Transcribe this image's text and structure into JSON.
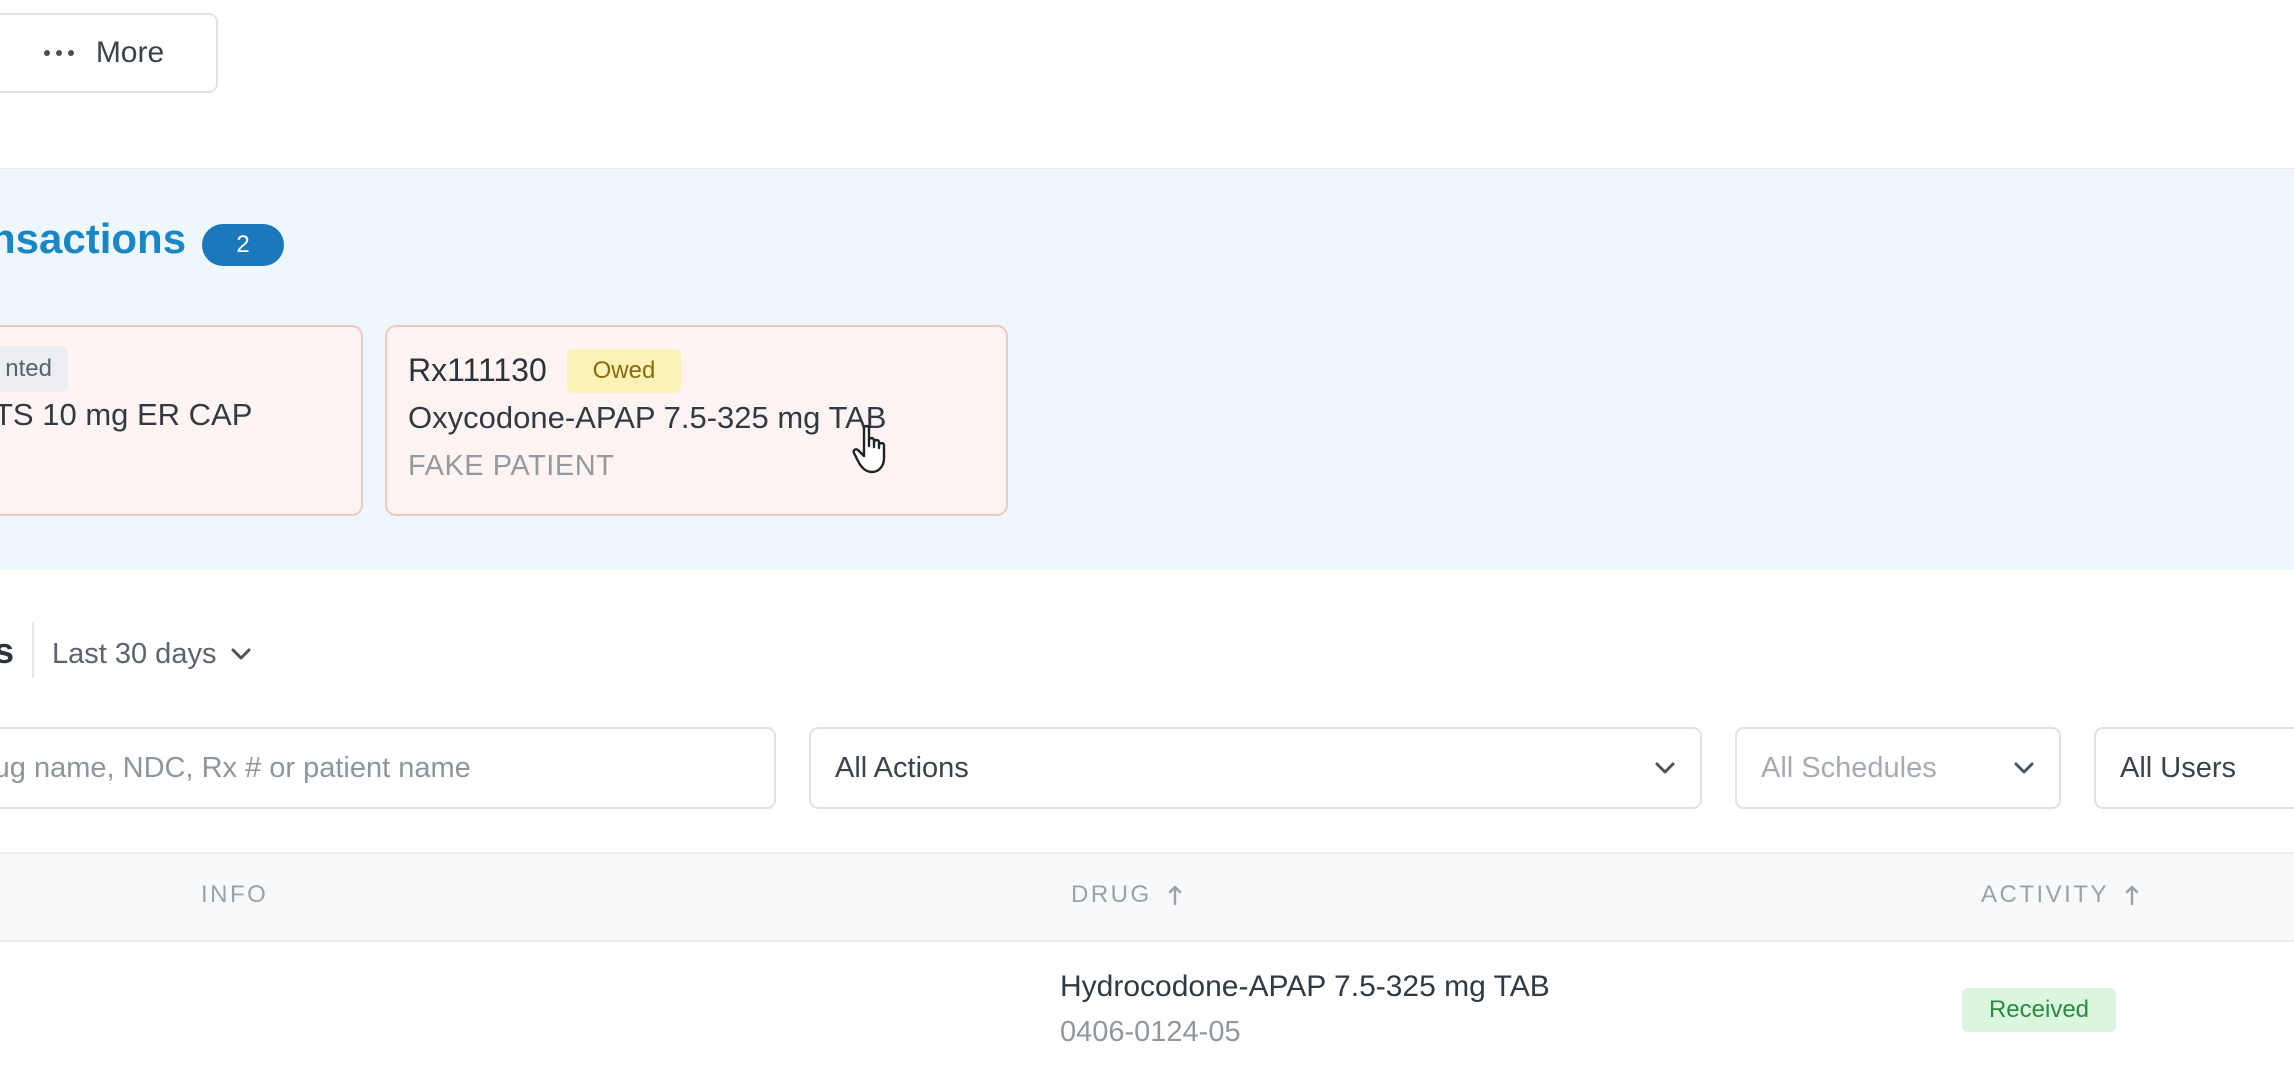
{
  "toolbar": {
    "more_label": "More"
  },
  "transactions": {
    "title": "nsactions",
    "count": "2",
    "cards": [
      {
        "status": "nted",
        "drug": "TS 10 mg ER CAP"
      },
      {
        "rx": "Rx111130",
        "status": "Owed",
        "drug": "Oxycodone-APAP 7.5-325 mg TAB",
        "patient": "FAKE PATIENT"
      }
    ]
  },
  "activity": {
    "heading": "s",
    "range": "Last 30 days"
  },
  "filters": {
    "search_placeholder": "rug name, NDC, Rx # or patient name",
    "actions": "All Actions",
    "schedules": "All Schedules",
    "users": "All Users"
  },
  "table": {
    "columns": [
      "INFO",
      "DRUG",
      "ACTIVITY"
    ],
    "rows": [
      {
        "drug": "Hydrocodone-APAP 7.5-325 mg TAB",
        "ndc": "0406-0124-05",
        "activity": "Received"
      }
    ]
  },
  "colors": {
    "accent": "#1a86c4",
    "band": "#eef8fc",
    "owed": "#fdf2b6",
    "received": "#dbf6df"
  },
  "icons": {
    "more": "ellipsis-icon",
    "dropdown": "chevron-down-icon",
    "sort": "arrow-up-icon",
    "cursor": "hand-pointer-icon"
  }
}
